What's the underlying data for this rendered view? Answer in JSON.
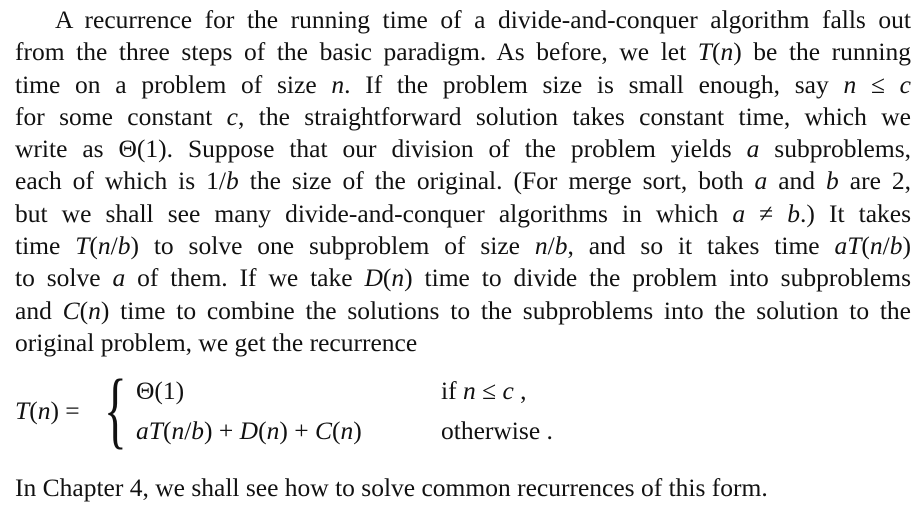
{
  "paragraph": [
    "A recurrence for the running time of a divide-and-conquer algorithm falls out",
    "from the three steps of the basic paradigm. As before, we let {T}({n}) be the running",
    "time on a problem of size {n}. If the problem size is small enough, say {n} ≤ {c}",
    "for some constant {c}, the straightforward solution takes constant time, which we",
    "write as Θ(1). Suppose that our division of the problem yields {a} subproblems,",
    "each of which is 1/{b} the size of the original. (For merge sort, both {a} and {b} are 2,",
    "but we shall see many divide-and-conquer algorithms in which {a} ≠ {b}.) It takes",
    "time {T}({n}/{b}) to solve one subproblem of size {n}/{b}, and so it takes time {aT}({n}/{b})",
    "to solve {a} of them. If we take {D}({n}) time to divide the problem into subproblems",
    "and {C}({n}) time to combine the solutions to the subproblems into the solution to the",
    "original problem, we get the recurrence"
  ],
  "equation": {
    "lhs": "{T}({n}) =",
    "case1_expr": "Θ(1)",
    "case1_cond": "if {n} ≤ {c} ,",
    "case2_expr": "{aT}({n}/{b}) + {D}({n}) + {C}({n})",
    "case2_cond": "otherwise ."
  },
  "closing": "In Chapter 4, we shall see how to solve common recurrences of this form."
}
